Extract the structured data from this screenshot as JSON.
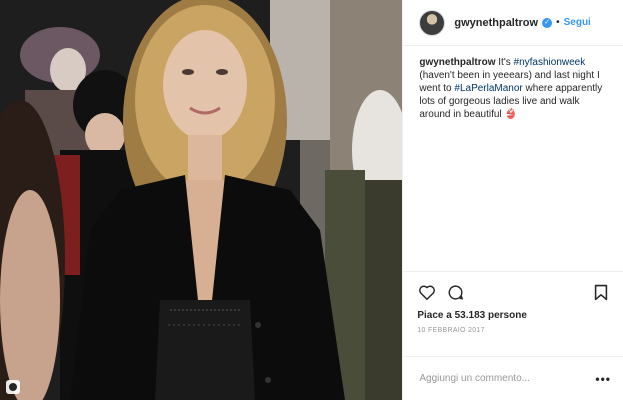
{
  "header": {
    "username": "gwynethpaltrow",
    "separator": "•",
    "follow_label": "Segui"
  },
  "caption": {
    "user": "gwynethpaltrow",
    "text_1": " It's ",
    "hashtag_1": "#nyfashionweek",
    "text_2": " (haven't been in yeeears) and last night I went to ",
    "hashtag_2": "#LaPerlaManor",
    "text_3": " where apparently lots of gorgeous ladies live and walk around in beautiful ",
    "emoji": "👙"
  },
  "actions": {
    "likes": "Piace a 53.183 persone",
    "date": "10 febbraio 2017",
    "icons": [
      "heart-icon",
      "comment-icon",
      "bookmark-icon"
    ]
  },
  "comment": {
    "placeholder": "Aggiungi un commento...",
    "more": "•••"
  },
  "colors": {
    "accent": "#3897f0",
    "hashtag": "#003569",
    "muted": "#999999",
    "border": "#efefef"
  }
}
